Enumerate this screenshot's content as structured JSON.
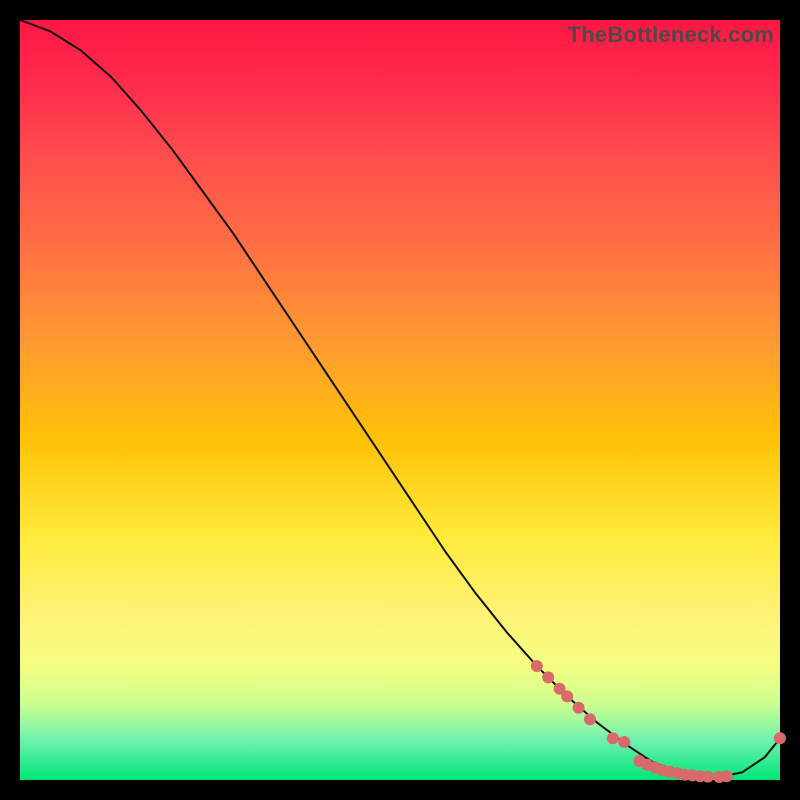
{
  "watermark": "TheBottleneck.com",
  "colors": {
    "dot": "#d86a6a",
    "curve": "#111111",
    "frame": "#000000",
    "gradient_top": "#ff1744",
    "gradient_bottom": "#00e676"
  },
  "chart_data": {
    "type": "line",
    "title": "",
    "xlabel": "",
    "ylabel": "",
    "xlim": [
      0,
      100
    ],
    "ylim": [
      0,
      100
    ],
    "grid": false,
    "legend": false,
    "series": [
      {
        "name": "curve",
        "x": [
          0,
          4,
          8,
          12,
          16,
          20,
          24,
          28,
          32,
          36,
          40,
          44,
          48,
          52,
          56,
          60,
          64,
          68,
          72,
          76,
          80,
          83,
          86,
          89,
          92,
          95,
          98,
          100
        ],
        "y": [
          100,
          98.5,
          96.0,
          92.5,
          88.0,
          83.0,
          77.5,
          72.0,
          66.0,
          60.0,
          54.0,
          48.0,
          42.0,
          36.0,
          30.0,
          24.5,
          19.5,
          15.0,
          11.0,
          7.5,
          4.5,
          2.5,
          1.2,
          0.5,
          0.4,
          1.0,
          3.0,
          5.5
        ]
      }
    ],
    "points": [
      {
        "x": 68,
        "y": 15.0
      },
      {
        "x": 69.5,
        "y": 13.5
      },
      {
        "x": 71,
        "y": 12.0
      },
      {
        "x": 72,
        "y": 11.0
      },
      {
        "x": 73.5,
        "y": 9.5
      },
      {
        "x": 75,
        "y": 8.0
      },
      {
        "x": 78,
        "y": 5.5
      },
      {
        "x": 79.5,
        "y": 5.0
      },
      {
        "x": 81.5,
        "y": 2.5
      },
      {
        "x": 82.5,
        "y": 2.0
      },
      {
        "x": 83.5,
        "y": 1.7
      },
      {
        "x": 84.5,
        "y": 1.3
      },
      {
        "x": 85.5,
        "y": 1.1
      },
      {
        "x": 86.5,
        "y": 0.9
      },
      {
        "x": 87.5,
        "y": 0.7
      },
      {
        "x": 88.5,
        "y": 0.6
      },
      {
        "x": 89.5,
        "y": 0.5
      },
      {
        "x": 90.5,
        "y": 0.45
      },
      {
        "x": 92,
        "y": 0.4
      },
      {
        "x": 93,
        "y": 0.5
      },
      {
        "x": 100,
        "y": 5.5
      }
    ],
    "gradient_meaning": "bottleneck severity (red high, green low)"
  }
}
